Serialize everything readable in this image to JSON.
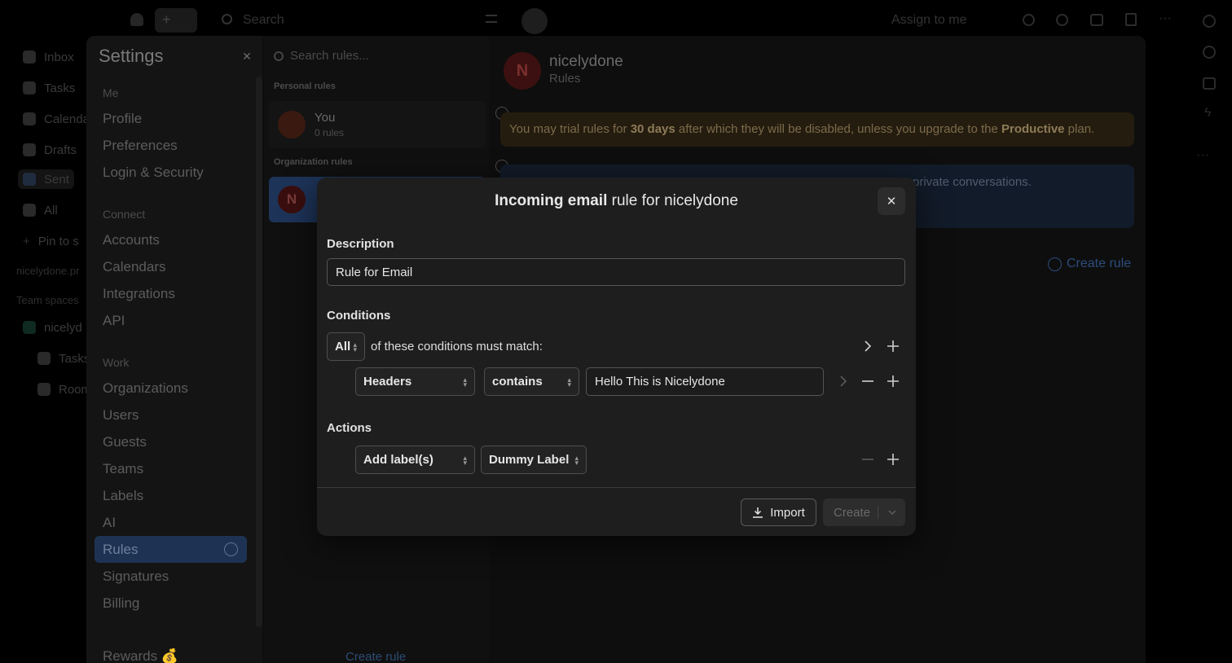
{
  "topbar": {
    "search_placeholder": "Search",
    "assign_label": "Assign to me"
  },
  "bg_nav": {
    "items": [
      "Inbox",
      "Tasks",
      "Calenda",
      "Drafts",
      "Sent",
      "All",
      "Pin to s"
    ],
    "workspace_label": "nicelydone.pr",
    "team_spaces": "Team spaces",
    "team_name": "nicelyd",
    "team_tasks": "Tasks",
    "team_rooms": "Room"
  },
  "settings": {
    "title": "Settings",
    "sections": [
      {
        "title": "Me",
        "items": [
          "Profile",
          "Preferences",
          "Login & Security"
        ]
      },
      {
        "title": "Connect",
        "items": [
          "Accounts",
          "Calendars",
          "Integrations",
          "API"
        ]
      },
      {
        "title": "Work",
        "items": [
          "Organizations",
          "Users",
          "Guests",
          "Teams",
          "Labels",
          "AI",
          "Rules",
          "Signatures",
          "Billing"
        ]
      }
    ],
    "rewards": "Rewards 💰",
    "active_item": "Rules"
  },
  "rules_list": {
    "search_placeholder": "Search rules...",
    "personal_header": "Personal rules",
    "personal": {
      "name": "You",
      "count": "0 rules"
    },
    "org_header": "Organization rules",
    "org_initial": "N",
    "create_rule": "Create rule"
  },
  "detail": {
    "initial": "N",
    "title": "nicelydone",
    "subtitle": "Rules",
    "warning_pre": "You may trial rules for ",
    "warning_days": "30 days",
    "warning_mid": " after which they will be disabled, unless you upgrade to the ",
    "warning_plan": "Productive",
    "warning_post": " plan.",
    "info_fragment": "private conversations.",
    "create_rule": "Create rule"
  },
  "modal": {
    "title_bold": "Incoming email",
    "title_rest": " rule for nicelydone",
    "description_label": "Description",
    "description_value": "Rule for Email",
    "conditions_label": "Conditions",
    "match_mode": "All",
    "match_text": "of these conditions must match:",
    "condition": {
      "field": "Headers",
      "operator": "contains",
      "value": "Hello This is Nicelydone"
    },
    "actions_label": "Actions",
    "action": {
      "type": "Add label(s)",
      "label": "Dummy Label"
    },
    "import_label": "Import",
    "create_label": "Create"
  }
}
